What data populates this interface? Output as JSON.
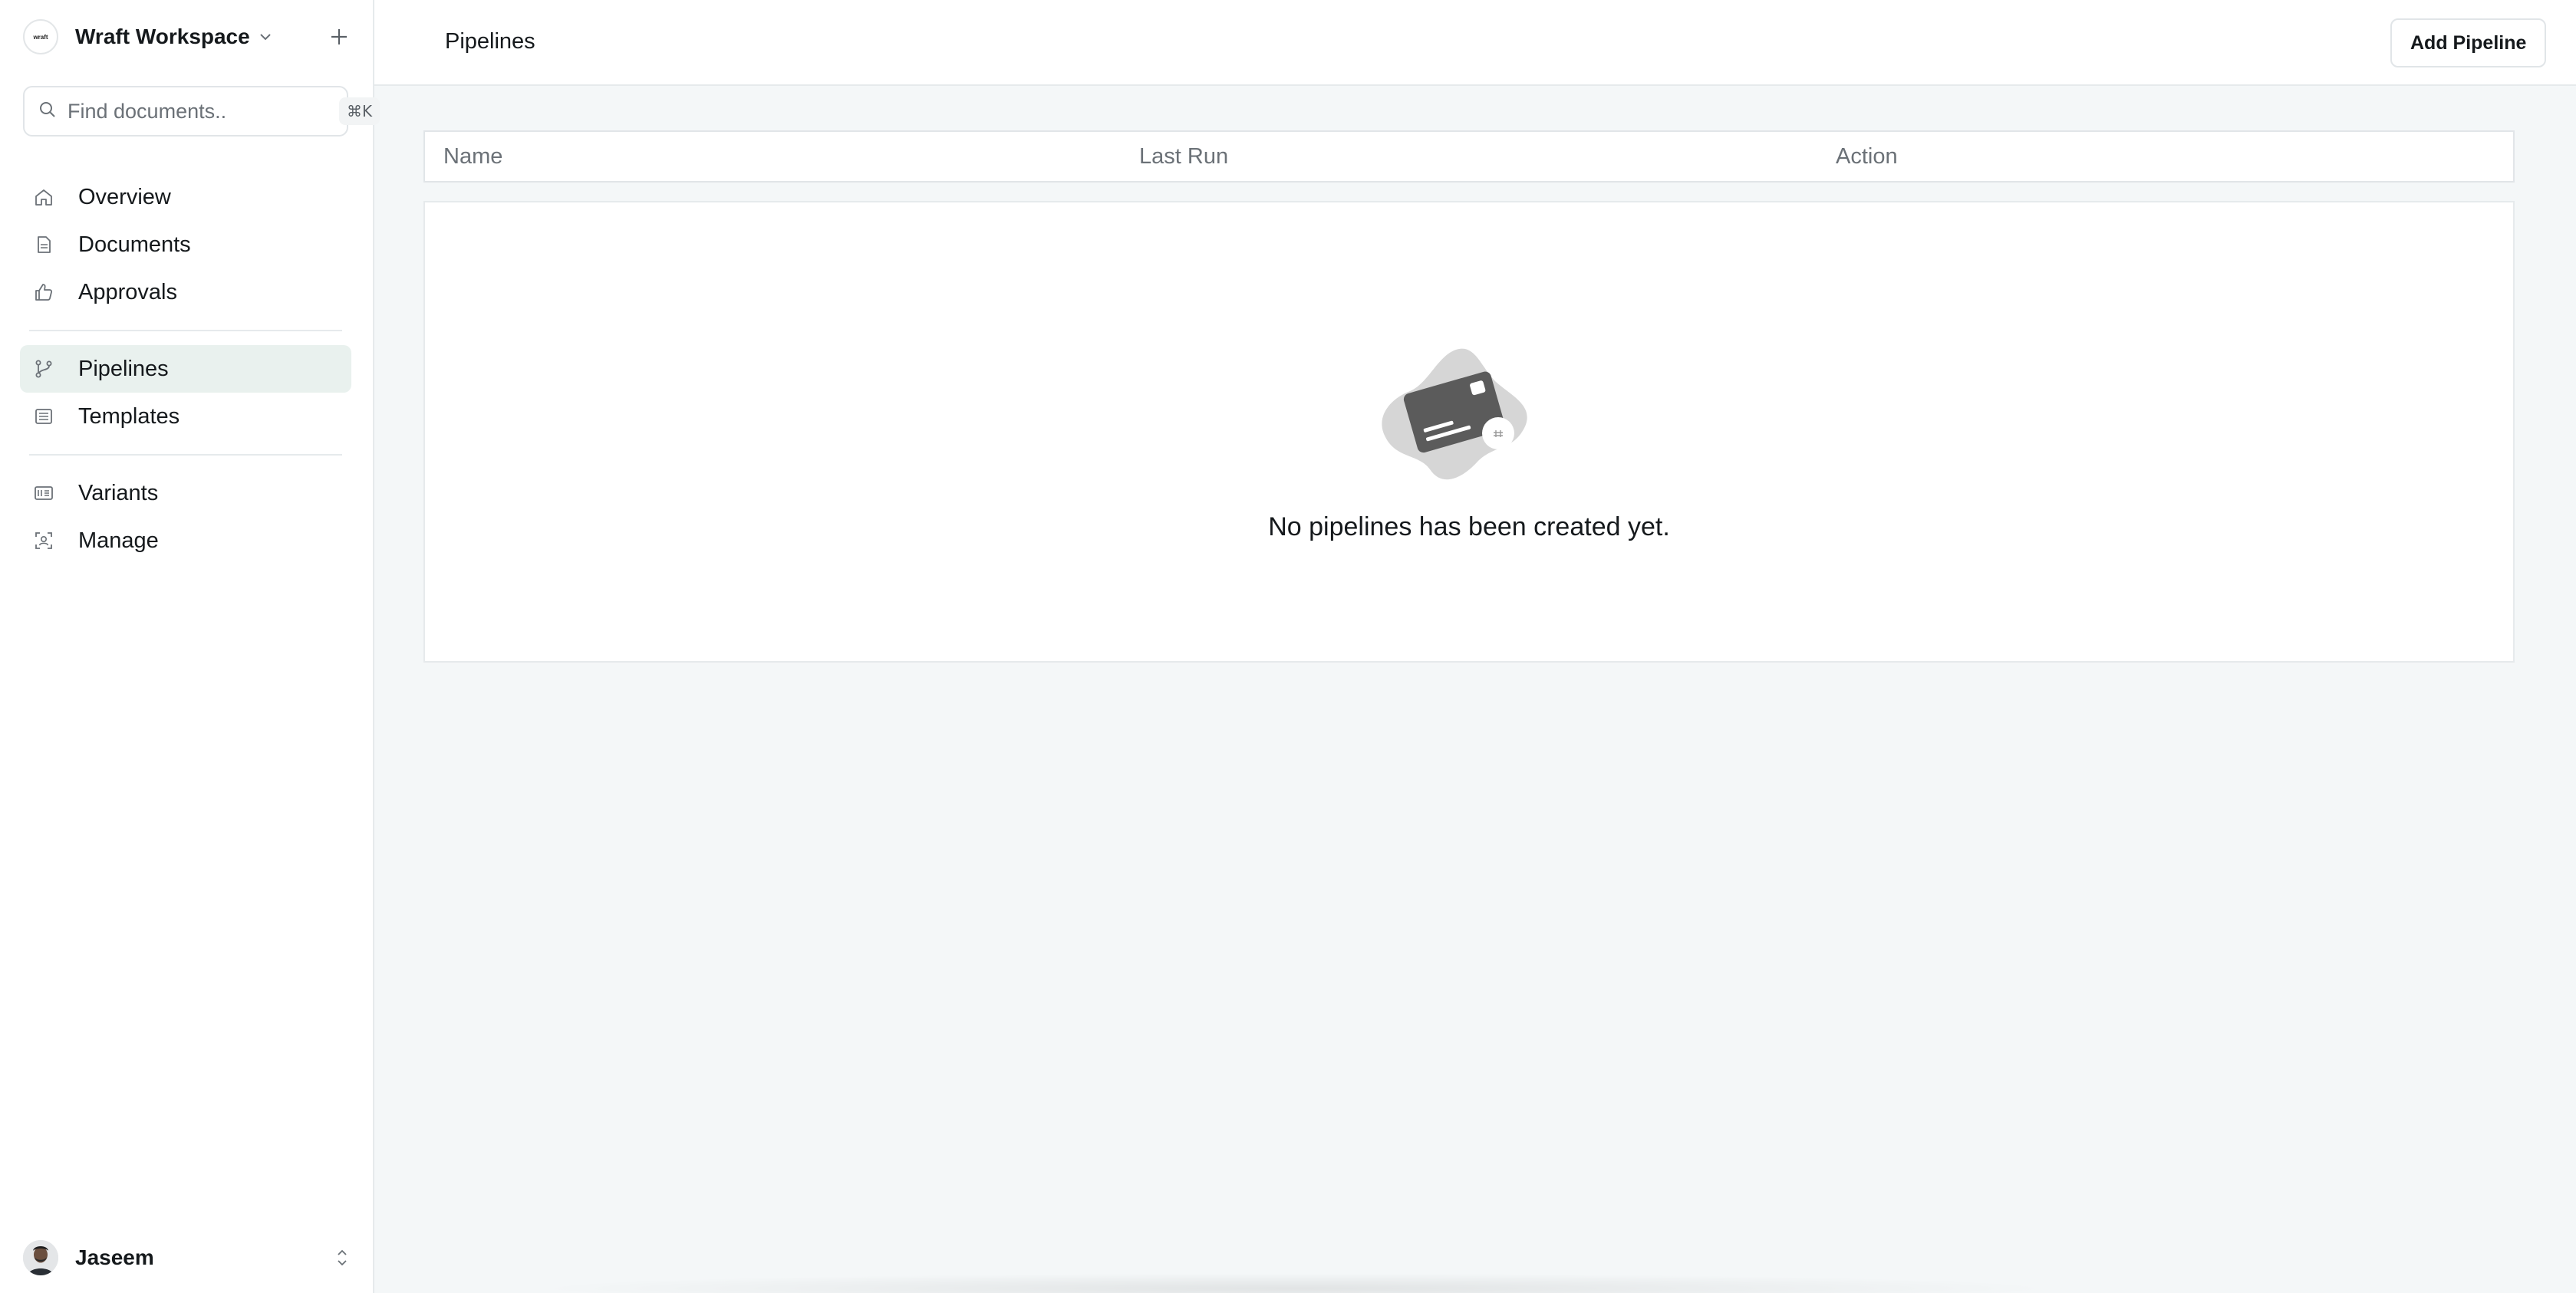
{
  "workspace": {
    "name": "Wraft Workspace",
    "logo_text": "wraft"
  },
  "search": {
    "placeholder": "Find documents..",
    "shortcut": "⌘K"
  },
  "nav": {
    "overview": "Overview",
    "documents": "Documents",
    "approvals": "Approvals",
    "pipelines": "Pipelines",
    "templates": "Templates",
    "variants": "Variants",
    "manage": "Manage"
  },
  "user": {
    "name": "Jaseem"
  },
  "header": {
    "title": "Pipelines",
    "add_label": "Add Pipeline"
  },
  "table": {
    "columns": [
      "Name",
      "Last Run",
      "Action"
    ]
  },
  "empty": {
    "message": "No pipelines has been created yet."
  },
  "colors": {
    "active_nav_bg": "#e9f1ee",
    "illustration": "#5b5b5b",
    "blob": "#d6d6d6"
  }
}
